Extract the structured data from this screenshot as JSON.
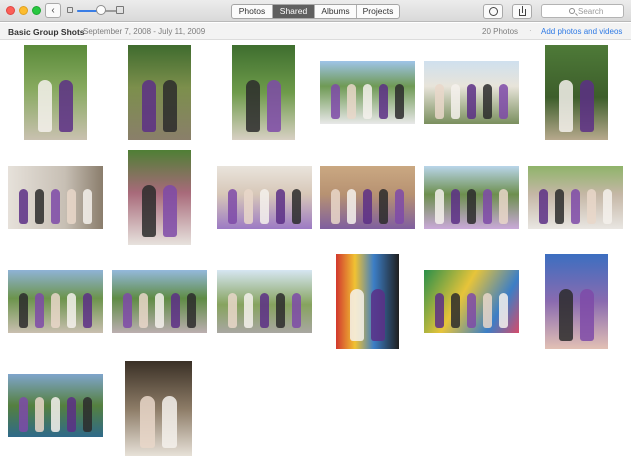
{
  "toolbar": {
    "back_label": "‹",
    "tabs": [
      {
        "label": "Photos",
        "active": false
      },
      {
        "label": "Shared",
        "active": true
      },
      {
        "label": "Albums",
        "active": false
      },
      {
        "label": "Projects",
        "active": false
      }
    ],
    "search_placeholder": "Search",
    "icons": [
      "back-icon",
      "zoom-small-icon",
      "zoom-large-icon",
      "info-icon",
      "share-icon",
      "search-icon"
    ]
  },
  "header": {
    "title": "Basic Group Shots",
    "dates": "September 7, 2008 - July 11, 2009",
    "count": "20 Photos",
    "separator": "·",
    "add_link": "Add photos and videos"
  },
  "zoom": {
    "value": 0.55
  },
  "colors": {
    "accent": "#2f7ae5",
    "active_tab": "#5f5f5f",
    "dress_purple": "#6a3a9a"
  },
  "photos": [
    {
      "name": "photo-bride-and-bridesmaid-1"
    },
    {
      "name": "photo-bride-and-bridesmaid-2"
    },
    {
      "name": "photo-bride-and-flower-girl"
    },
    {
      "name": "photo-bridal-party-outdoors"
    },
    {
      "name": "photo-groomsmen-gazebo"
    },
    {
      "name": "photo-bride-and-groom-1"
    },
    {
      "name": "photo-rings-hands"
    },
    {
      "name": "photo-bride-portrait"
    },
    {
      "name": "photo-group-gazebo-1"
    },
    {
      "name": "photo-group-bench"
    },
    {
      "name": "photo-group-gazebo-2"
    },
    {
      "name": "photo-family-group-1"
    },
    {
      "name": "photo-family-group-2"
    },
    {
      "name": "photo-family-group-3"
    },
    {
      "name": "photo-park-pavilion"
    },
    {
      "name": "photo-couple-colorful-wall"
    },
    {
      "name": "photo-couple-mural"
    },
    {
      "name": "photo-couple-closeup"
    },
    {
      "name": "photo-university-sign"
    },
    {
      "name": "photo-framed-portrait"
    }
  ]
}
